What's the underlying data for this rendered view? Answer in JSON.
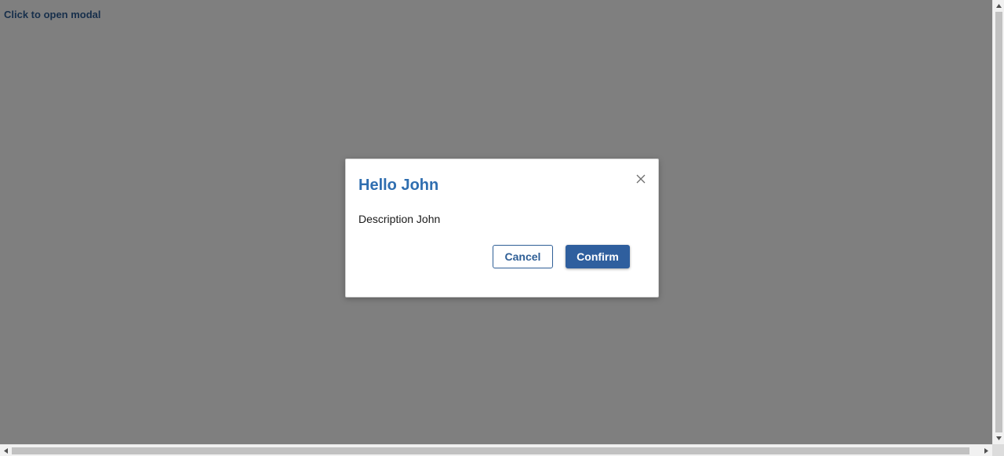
{
  "page": {
    "open_link_label": "Click to open modal"
  },
  "modal": {
    "title": "Hello John",
    "description": "Description John",
    "cancel_label": "Cancel",
    "confirm_label": "Confirm",
    "close_icon": "close-icon"
  },
  "colors": {
    "accent": "#2f6eb0",
    "primary_button": "#2f5f9e",
    "link": "#2f5f96",
    "backdrop": "rgba(0,0,0,0.5)"
  },
  "icons": {
    "scroll_up": "chevron-up-icon",
    "scroll_down": "chevron-down-icon",
    "scroll_left": "chevron-left-icon",
    "scroll_right": "chevron-right-icon"
  }
}
